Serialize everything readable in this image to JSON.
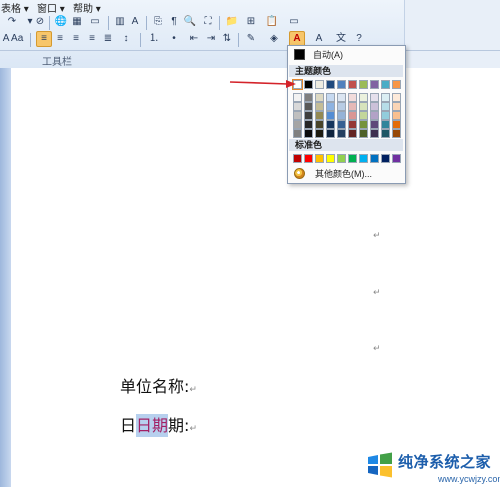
{
  "menubar": {
    "items": [
      "表格 ▾",
      "窗口 ▾",
      "帮助 ▾"
    ]
  },
  "toolbar": {
    "label": "工具栏"
  },
  "color_picker": {
    "auto_label": "自动(A)",
    "theme_heading": "主题颜色",
    "standard_heading": "标准色",
    "more_label": "其他颜色(M)...",
    "theme_top": [
      "#ffffff",
      "#000000",
      "#eeece1",
      "#1f497d",
      "#4f81bd",
      "#c0504d",
      "#9bbb59",
      "#8064a2",
      "#4bacc6",
      "#f79646"
    ],
    "theme_tints": [
      [
        "#f2f2f2",
        "#7f7f7f",
        "#ddd9c3",
        "#c6d9f0",
        "#dbe5f1",
        "#f2dcdb",
        "#ebf1dd",
        "#e5e0ec",
        "#dbeef3",
        "#fdeada"
      ],
      [
        "#d8d8d8",
        "#595959",
        "#c4bd97",
        "#8db3e2",
        "#b8cce4",
        "#e5b9b7",
        "#d7e3bc",
        "#ccc1d9",
        "#b7dde8",
        "#fbd5b5"
      ],
      [
        "#bfbfbf",
        "#3f3f3f",
        "#938953",
        "#548dd4",
        "#95b3d7",
        "#d99694",
        "#c3d69b",
        "#b2a2c7",
        "#92cddc",
        "#fac08f"
      ],
      [
        "#a5a5a5",
        "#262626",
        "#494429",
        "#17365d",
        "#366092",
        "#953734",
        "#76923c",
        "#5f497a",
        "#31859b",
        "#e36c09"
      ],
      [
        "#7f7f7f",
        "#0c0c0c",
        "#1d1b10",
        "#0f243e",
        "#244061",
        "#632423",
        "#4f6128",
        "#3f3151",
        "#205867",
        "#974806"
      ]
    ],
    "standard": [
      "#c00000",
      "#ff0000",
      "#ffc000",
      "#ffff00",
      "#92d050",
      "#00b050",
      "#00b0f0",
      "#0070c0",
      "#002060",
      "#7030a0"
    ]
  },
  "document": {
    "paragraph_mark": "↵",
    "line1": "单位名称:",
    "line2_start": "日",
    "line2_highlight": "日期",
    "line2_end": "期:"
  },
  "watermark": {
    "title": "纯净系统之家",
    "url": "www.ycwjzy.com"
  }
}
